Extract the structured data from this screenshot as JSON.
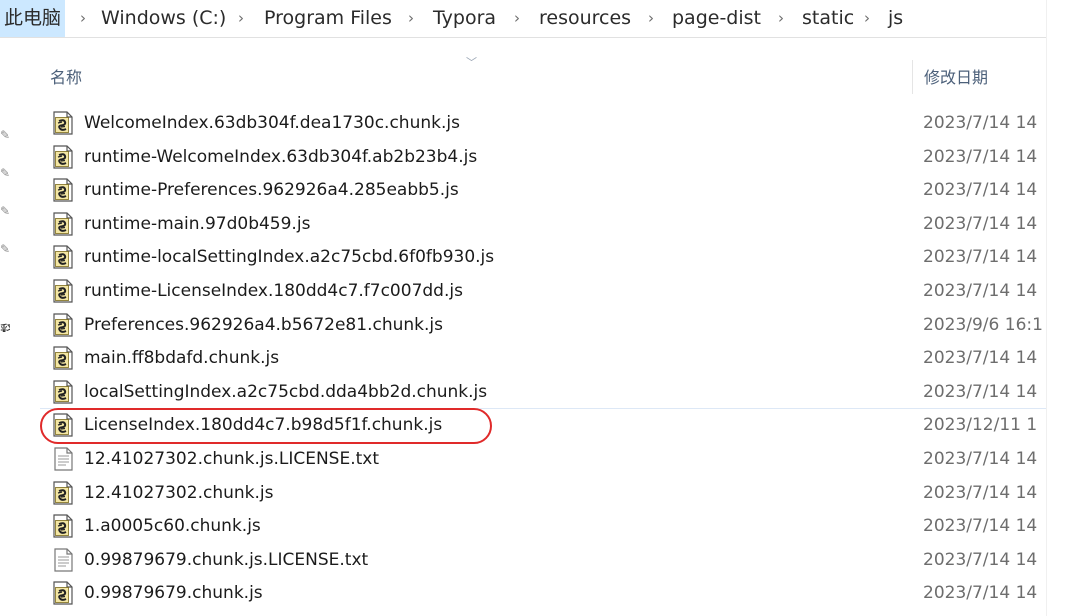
{
  "breadcrumb": {
    "items": [
      "此电脑",
      "Windows (C:)",
      "Program Files",
      "Typora",
      "resources",
      "page-dist",
      "static",
      "js"
    ],
    "separator": "›"
  },
  "columns": {
    "name": "名称",
    "date_modified": "修改日期"
  },
  "files": [
    {
      "name": "WelcomeIndex.63db304f.dea1730c.chunk.js",
      "date": "2023/7/14 14",
      "icon": "js-file-icon"
    },
    {
      "name": "runtime-WelcomeIndex.63db304f.ab2b23b4.js",
      "date": "2023/7/14 14",
      "icon": "js-file-icon"
    },
    {
      "name": "runtime-Preferences.962926a4.285eabb5.js",
      "date": "2023/7/14 14",
      "icon": "js-file-icon"
    },
    {
      "name": "runtime-main.97d0b459.js",
      "date": "2023/7/14 14",
      "icon": "js-file-icon"
    },
    {
      "name": "runtime-localSettingIndex.a2c75cbd.6f0fb930.js",
      "date": "2023/7/14 14",
      "icon": "js-file-icon"
    },
    {
      "name": "runtime-LicenseIndex.180dd4c7.f7c007dd.js",
      "date": "2023/7/14 14",
      "icon": "js-file-icon"
    },
    {
      "name": "Preferences.962926a4.b5672e81.chunk.js",
      "date": "2023/9/6 16:1",
      "icon": "js-file-icon"
    },
    {
      "name": "main.ff8bdafd.chunk.js",
      "date": "2023/7/14 14",
      "icon": "js-file-icon"
    },
    {
      "name": "localSettingIndex.a2c75cbd.dda4bb2d.chunk.js",
      "date": "2023/7/14 14",
      "icon": "js-file-icon"
    },
    {
      "name": "LicenseIndex.180dd4c7.b98d5f1f.chunk.js",
      "date": "2023/12/11 1",
      "icon": "js-file-icon"
    },
    {
      "name": "12.41027302.chunk.js.LICENSE.txt",
      "date": "2023/7/14 14",
      "icon": "text-file-icon"
    },
    {
      "name": "12.41027302.chunk.js",
      "date": "2023/7/14 14",
      "icon": "js-file-icon"
    },
    {
      "name": "1.a0005c60.chunk.js",
      "date": "2023/7/14 14",
      "icon": "js-file-icon"
    },
    {
      "name": "0.99879679.chunk.js.LICENSE.txt",
      "date": "2023/7/14 14",
      "icon": "text-file-icon"
    },
    {
      "name": "0.99879679.chunk.js",
      "date": "2023/7/14 14",
      "icon": "js-file-icon"
    }
  ],
  "annotation": {
    "circled_file_index": 9,
    "circle_color": "#e02a2a"
  },
  "nav": {
    "partial_char": "释"
  },
  "colors": {
    "breadcrumb_root_bg": "#cce8ff",
    "header_text": "#4c607a",
    "date_text": "#6d6d6d"
  }
}
